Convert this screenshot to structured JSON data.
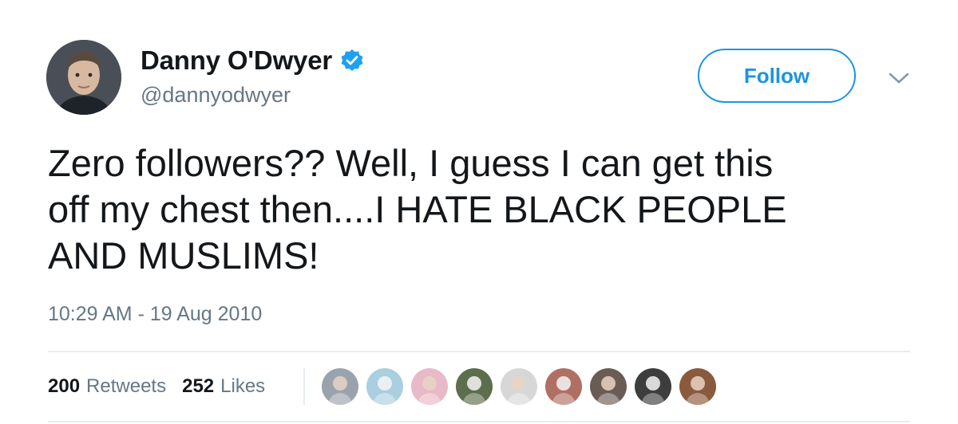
{
  "user": {
    "display_name": "Danny O'Dwyer",
    "handle": "@dannyodwyer",
    "avatar_icon": "profile-photo",
    "verified_icon": "verified-badge-icon"
  },
  "actions": {
    "follow_label": "Follow",
    "more_icon": "chevron-down-icon"
  },
  "tweet": {
    "text": "Zero followers?? Well, I guess I can get this\noff my chest then....I HATE BLACK PEOPLE\nAND MUSLIMS!",
    "timestamp": "10:29 AM - 19 Aug 2010"
  },
  "stats": {
    "retweets_count": "200",
    "retweets_label": "Retweets",
    "likes_count": "252",
    "likes_label": "Likes"
  },
  "likers": [
    {
      "icon": "liker-avatar-1",
      "color": "#9aa3ad"
    },
    {
      "icon": "liker-avatar-2",
      "color": "#a9cfe0"
    },
    {
      "icon": "liker-avatar-3",
      "color": "#e8b9c6"
    },
    {
      "icon": "liker-avatar-4",
      "color": "#5c6e4c"
    },
    {
      "icon": "liker-avatar-5",
      "color": "#d7d7d7"
    },
    {
      "icon": "liker-avatar-6",
      "color": "#b06f63"
    },
    {
      "icon": "liker-avatar-7",
      "color": "#6b5b55"
    },
    {
      "icon": "liker-avatar-8",
      "color": "#3d3d3d"
    },
    {
      "icon": "liker-avatar-9",
      "color": "#8a5a3c"
    }
  ],
  "colors": {
    "accent": "#1b95e0",
    "text": "#14171a",
    "secondary_text": "#657786",
    "divider": "#e6ecf0"
  }
}
